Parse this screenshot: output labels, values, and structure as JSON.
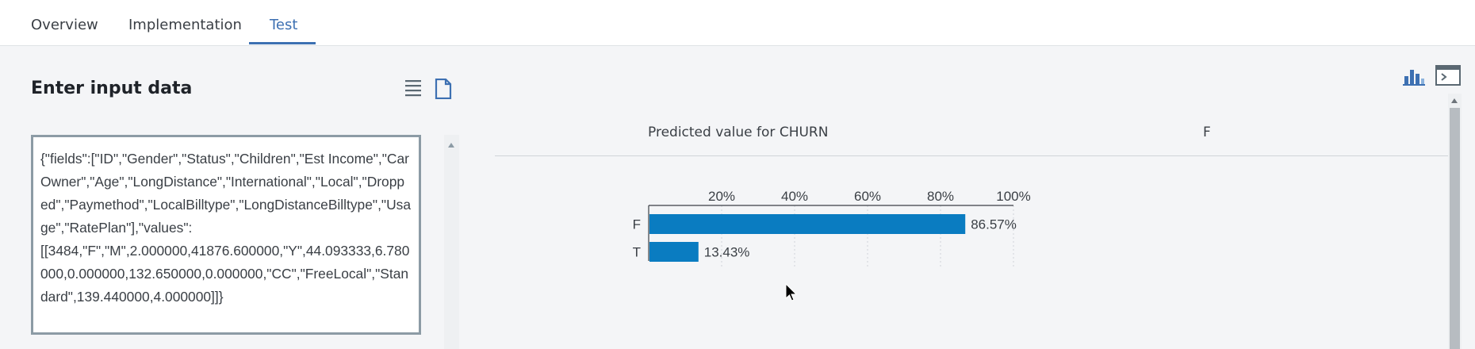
{
  "tabs": [
    {
      "label": "Overview",
      "active": false
    },
    {
      "label": "Implementation",
      "active": false
    },
    {
      "label": "Test",
      "active": true
    }
  ],
  "input_panel": {
    "title": "Enter input data",
    "list_view_icon": "list-icon",
    "json_view_icon": "document-icon",
    "input_value": "{\"fields\":[\"ID\",\"Gender\",\"Status\",\"Children\",\"Est Income\",\"Car Owner\",\"Age\",\"LongDistance\",\"International\",\"Local\",\"Dropped\",\"Paymethod\",\"LocalBilltype\",\"LongDistanceBilltype\",\"Usage\",\"RatePlan\"],\"values\":\n[[3484,\"F\",\"M\",2.000000,41876.600000,\"Y\",44.093333,6.780000,0.000000,132.650000,0.000000,\"CC\",\"FreeLocal\",\"Standard\",139.440000,4.000000]]}"
  },
  "result_panel": {
    "chart_view_icon": "bar-chart-icon",
    "code_view_icon": "terminal-icon",
    "prediction_label": "Predicted value for CHURN",
    "prediction_value": "F"
  },
  "colors": {
    "accent": "#3d70b2",
    "bar": "#0a7cc1"
  },
  "chart_data": {
    "type": "bar",
    "orientation": "horizontal",
    "categories": [
      "F",
      "T"
    ],
    "values": [
      86.57,
      13.43
    ],
    "data_labels": [
      "86.57%",
      "13.43%"
    ],
    "xticks": [
      "20%",
      "40%",
      "60%",
      "80%",
      "100%"
    ],
    "xlim": [
      0,
      100
    ],
    "grid": true
  }
}
